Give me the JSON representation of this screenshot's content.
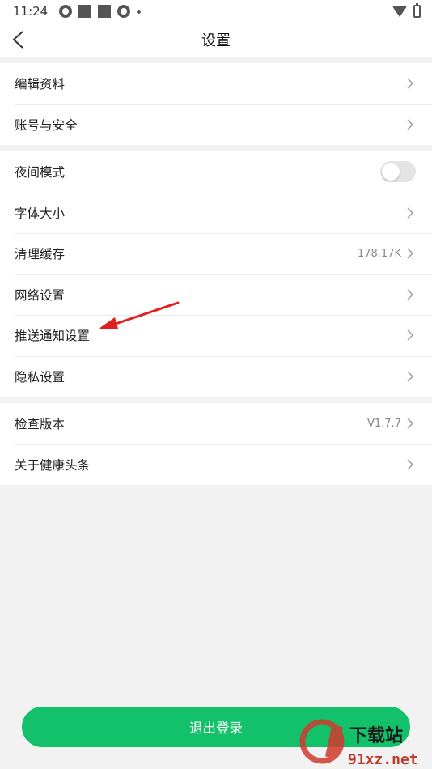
{
  "status_bar": {
    "time": "11:24"
  },
  "nav": {
    "title": "设置"
  },
  "groups": [
    {
      "items": [
        {
          "label": "编辑资料"
        },
        {
          "label": "账号与安全"
        }
      ]
    },
    {
      "items": [
        {
          "label": "夜间模式",
          "toggle": false
        },
        {
          "label": "字体大小"
        },
        {
          "label": "清理缓存",
          "value": "178.17K"
        },
        {
          "label": "网络设置"
        },
        {
          "label": "推送通知设置"
        },
        {
          "label": "隐私设置"
        }
      ]
    },
    {
      "items": [
        {
          "label": "检查版本",
          "value": "V1.7.7"
        },
        {
          "label": "关于健康头条"
        }
      ]
    }
  ],
  "logout": {
    "label": "退出登录"
  },
  "colors": {
    "accent": "#12c16a",
    "annotation_arrow": "#e02020"
  },
  "watermark": {
    "text": "下载站",
    "url": "91xz.net"
  }
}
